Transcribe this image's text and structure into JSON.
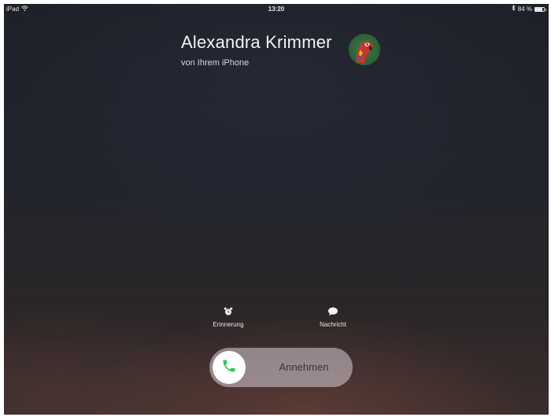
{
  "status_bar": {
    "device": "iPad",
    "time": "13:20",
    "battery_percent": "84 %",
    "battery_level": 0.84
  },
  "caller": {
    "name": "Alexandra Krimmer",
    "subtitle": "von Ihrem iPhone",
    "avatar_icon": "parrot-avatar"
  },
  "actions": {
    "reminder_label": "Erinnerung",
    "reminder_icon": "alarm-clock-icon",
    "message_label": "Nachricht",
    "message_icon": "speech-bubble-icon"
  },
  "answer_slider": {
    "label": "Annehmen",
    "icon": "phone-icon",
    "accent": "#34c759"
  }
}
